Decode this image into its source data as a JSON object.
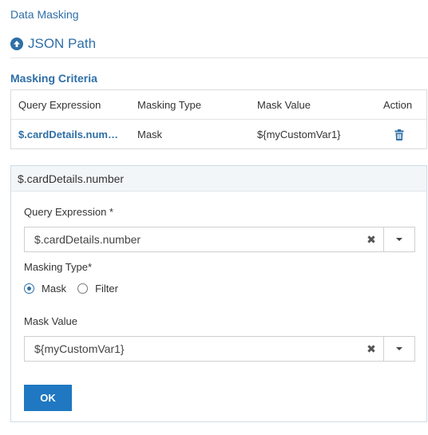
{
  "header": {
    "breadcrumb": "Data Masking",
    "json_path_label": "JSON Path",
    "json_path_icon": "circle-up-arrow-icon"
  },
  "criteria": {
    "title": "Masking Criteria",
    "columns": [
      "Query Expression",
      "Masking Type",
      "Mask Value",
      "Action"
    ],
    "rows": [
      {
        "query_expression": "$.cardDetails.num…",
        "masking_type": "Mask",
        "mask_value": "${myCustomVar1}",
        "action_icon": "trash-icon"
      }
    ]
  },
  "editor": {
    "title": "$.cardDetails.number",
    "query_expression": {
      "label": "Query Expression *",
      "value": "$.cardDetails.number",
      "clear_glyph": "✖"
    },
    "masking_type": {
      "label": "Masking Type*",
      "options": [
        "Mask",
        "Filter"
      ],
      "selected": "Mask"
    },
    "mask_value": {
      "label": "Mask Value",
      "value": "${myCustomVar1}",
      "clear_glyph": "✖"
    },
    "ok_label": "OK"
  },
  "colors": {
    "accent": "#2f6fa7",
    "button": "#1f78c1",
    "panel_border": "#cfdbe6"
  }
}
